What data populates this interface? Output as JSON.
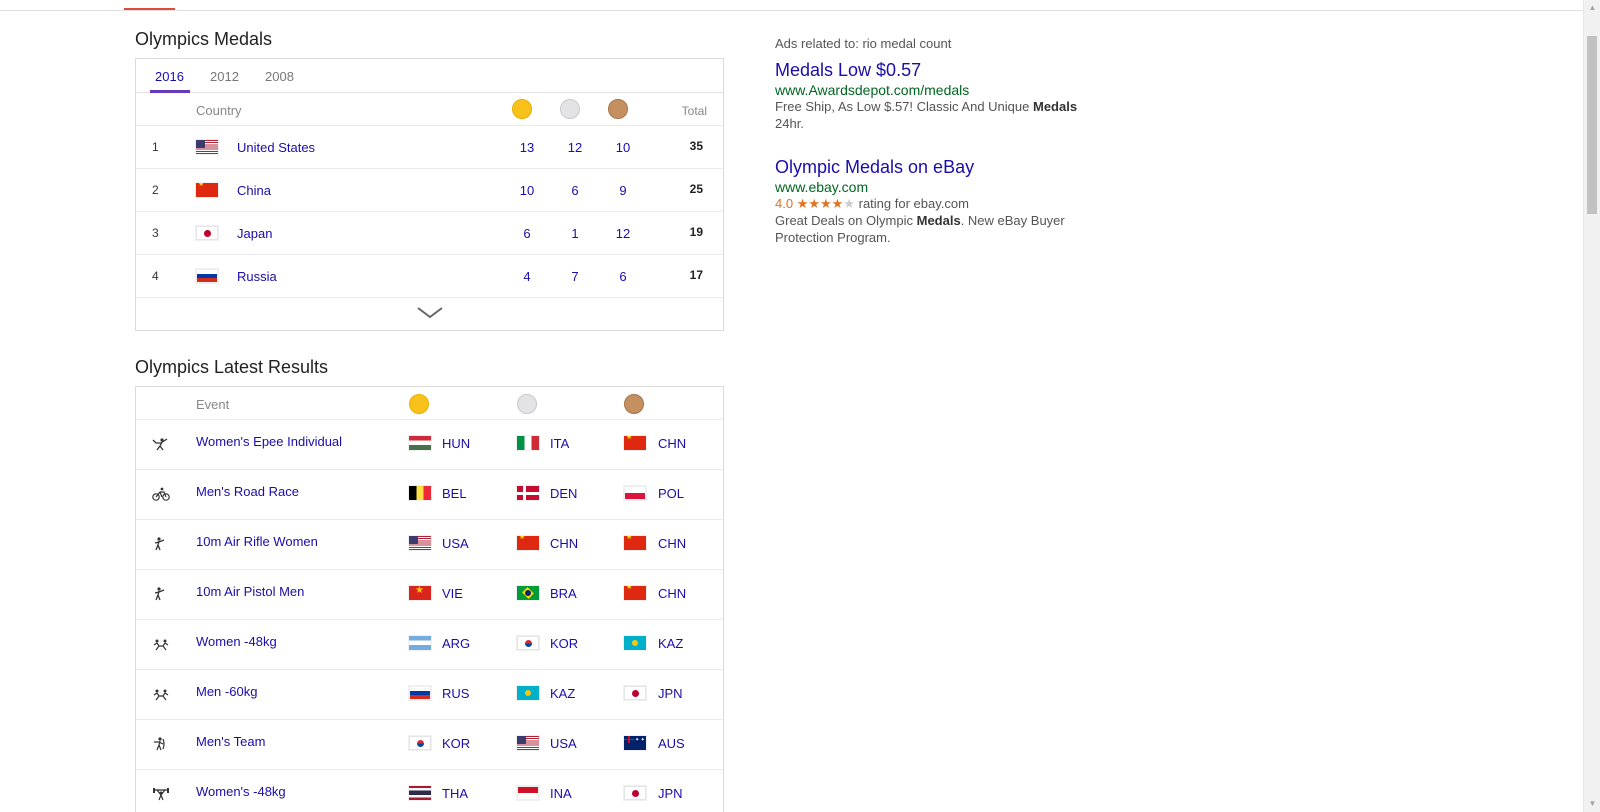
{
  "medals_section": {
    "title": "Olympics Medals",
    "tabs": [
      "2016",
      "2012",
      "2008"
    ],
    "header": {
      "country": "Country",
      "total": "Total"
    },
    "rows": [
      {
        "rank": "1",
        "country": "United States",
        "flag": "us-flag-icon",
        "gold": "13",
        "silver": "12",
        "bronze": "10",
        "total": "35"
      },
      {
        "rank": "2",
        "country": "China",
        "flag": "cn-flag-icon",
        "gold": "10",
        "silver": "6",
        "bronze": "9",
        "total": "25"
      },
      {
        "rank": "3",
        "country": "Japan",
        "flag": "jp-flag-icon",
        "gold": "6",
        "silver": "1",
        "bronze": "12",
        "total": "19"
      },
      {
        "rank": "4",
        "country": "Russia",
        "flag": "ru-flag-icon",
        "gold": "4",
        "silver": "7",
        "bronze": "6",
        "total": "17"
      }
    ]
  },
  "results_section": {
    "title": "Olympics Latest Results",
    "header": {
      "event": "Event"
    },
    "rows": [
      {
        "sport_icon": "fencing-icon",
        "event": "Women's Epee Individual",
        "gold": "HUN",
        "silver": "ITA",
        "bronze": "CHN"
      },
      {
        "sport_icon": "cycling-icon",
        "event": "Men's Road Race",
        "gold": "BEL",
        "silver": "DEN",
        "bronze": "POL"
      },
      {
        "sport_icon": "shooting-icon",
        "event": "10m Air Rifle Women",
        "gold": "USA",
        "silver": "CHN",
        "bronze": "CHN"
      },
      {
        "sport_icon": "shooting-icon",
        "event": "10m Air Pistol Men",
        "gold": "VIE",
        "silver": "BRA",
        "bronze": "CHN"
      },
      {
        "sport_icon": "judo-icon",
        "event": "Women -48kg",
        "gold": "ARG",
        "silver": "KOR",
        "bronze": "KAZ"
      },
      {
        "sport_icon": "judo-icon",
        "event": "Men -60kg",
        "gold": "RUS",
        "silver": "KAZ",
        "bronze": "JPN"
      },
      {
        "sport_icon": "archery-icon",
        "event": "Men's Team",
        "gold": "KOR",
        "silver": "USA",
        "bronze": "AUS"
      },
      {
        "sport_icon": "weightlifting-icon",
        "event": "Women's -48kg",
        "gold": "THA",
        "silver": "INA",
        "bronze": "JPN"
      }
    ]
  },
  "ads": {
    "header": "Ads related to: rio medal count",
    "items": [
      {
        "title": "Medals Low $0.57",
        "url": "www.Awardsdepot.com/medals",
        "desc_pre": "Free Ship, As Low $.57! Classic And Unique ",
        "desc_bold": "Medals",
        "desc_post": " 24hr."
      },
      {
        "title": "Olympic Medals on eBay",
        "url": "www.ebay.com",
        "rating_score": "4.0",
        "rating_text": "rating for ebay.com",
        "desc_pre": "Great Deals on Olympic ",
        "desc_bold": "Medals",
        "desc_post": ". New eBay Buyer Protection Program."
      }
    ]
  },
  "colors": {
    "link": "#1a0dab",
    "ad_url": "#006621",
    "tab_accent": "#673ab7",
    "gold": "#f9c21b",
    "silver": "#e3e3e6",
    "bronze": "#c49062"
  }
}
